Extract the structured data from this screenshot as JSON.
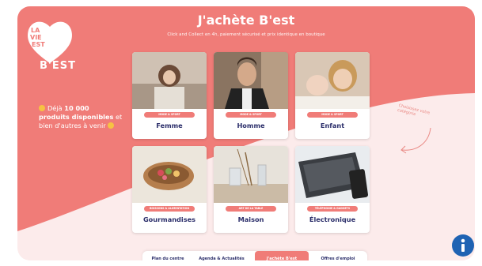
{
  "brand": {
    "logo_line1": "LA",
    "logo_line2": "VIE",
    "logo_line3": "EST",
    "logo_best": "B'EST"
  },
  "header": {
    "title": "J'achète B'est",
    "subtitle": "Click and Collect en 4h, paiement sécurisé et prix identique en boutique"
  },
  "promo": {
    "prefix": "Déjà ",
    "count": "10 000",
    "highlight": "produits disponibles",
    "suffix": " et bien d'autres à venir"
  },
  "annotation": "Choisissez votre catégorie",
  "categories": [
    {
      "tag": "MODE & SPORT",
      "label": "Femme"
    },
    {
      "tag": "MODE & SPORT",
      "label": "Homme"
    },
    {
      "tag": "MODE & SPORT",
      "label": "Enfant"
    },
    {
      "tag": "BOISSONS & ALIMENTATION",
      "label": "Gourmandises"
    },
    {
      "tag": "ART DE LA TABLE",
      "label": "Maison"
    },
    {
      "tag": "TÉLÉPHONIE & GADGETS",
      "label": "Électronique"
    }
  ],
  "nav": {
    "items": [
      "Plan du centre",
      "Agenda & Actualités",
      "J'achète B'est",
      "Offres d'emploi"
    ],
    "active_index": 2
  },
  "colors": {
    "accent": "#f07c78",
    "navy": "#2c2f6b",
    "info": "#1f63b3"
  }
}
